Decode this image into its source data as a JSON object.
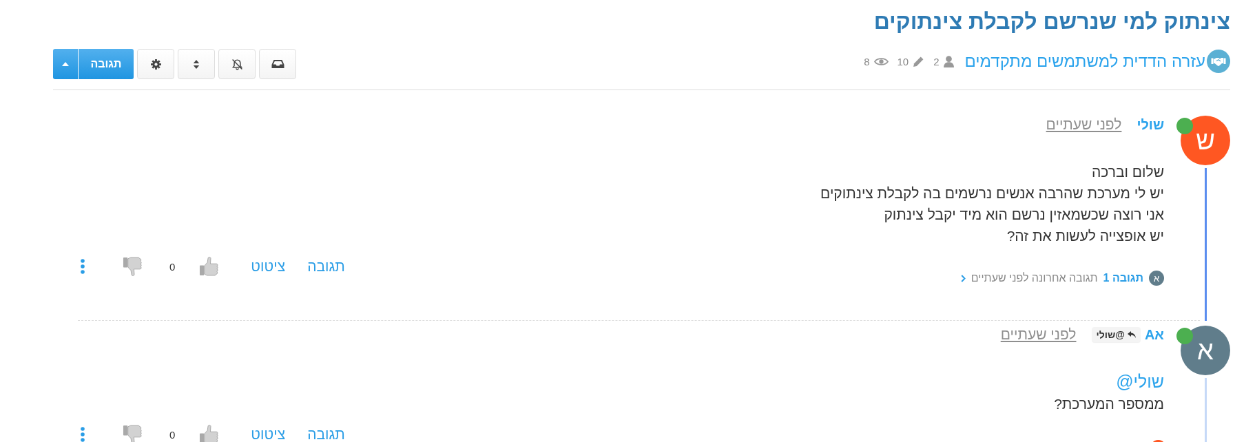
{
  "topic": {
    "title": "צינתוק למי שנרשם לקבלת צינתוקים",
    "category": "עזרה הדדית למשתמשים מתקדמים",
    "stats": {
      "posters": "2",
      "posts": "10",
      "views": "8"
    }
  },
  "toolbar": {
    "reply_button": "תגובה"
  },
  "posts": [
    {
      "author": "שולי",
      "avatar": {
        "letter": "ש",
        "color": "#ff5722"
      },
      "online": true,
      "thread_line_active": true,
      "time": "לפני שעתיים",
      "body": [
        {
          "kind": "text",
          "text": "שלום וברכה"
        },
        {
          "kind": "text",
          "text": "יש לי מערכת שהרבה אנשים נרשמים בה לקבלת צינתוקים"
        },
        {
          "kind": "text",
          "text": "אני רוצה שכשמאזין נרשם הוא מיד יקבל צינתוק"
        },
        {
          "kind": "text",
          "text": "יש אופצייה לעשות את זה?"
        }
      ],
      "replies": {
        "avatar": {
          "letter": "א",
          "color": "#607d8b"
        },
        "count": "תגובה 1",
        "last_reply": "תגובה אחרונה לפני שעתיים"
      },
      "actions": {
        "reply": "תגובה",
        "quote": "ציטוט",
        "votes": "0"
      }
    },
    {
      "author": "אA",
      "avatar": {
        "letter": "א",
        "color": "#607d8b"
      },
      "online": true,
      "thread_line_active": false,
      "reply_to": "@שולי",
      "time": "לפני שעתיים",
      "body": [
        {
          "kind": "mention",
          "text": "@שולי"
        },
        {
          "kind": "text",
          "text": "ממספר המערכת?"
        }
      ],
      "replies": {
        "avatar": {
          "color": "#ff5722"
        }
      },
      "actions": {
        "reply": "תגובה",
        "quote": "ציטוט",
        "votes": "0"
      }
    }
  ]
}
